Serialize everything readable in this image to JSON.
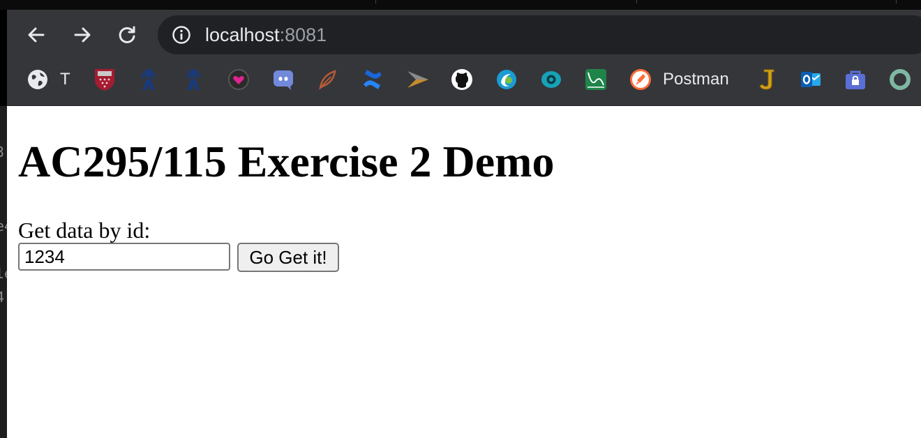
{
  "browser": {
    "address": {
      "host": "localhost",
      "port": ":8081"
    },
    "bookmarks": [
      {
        "icon": "globe-icon",
        "label": "T"
      },
      {
        "icon": "shield-crest-icon",
        "label": ""
      },
      {
        "icon": "butler-icon",
        "label": ""
      },
      {
        "icon": "butler-icon",
        "label": ""
      },
      {
        "icon": "heart-circle-icon",
        "label": ""
      },
      {
        "icon": "discord-icon",
        "label": ""
      },
      {
        "icon": "feather-icon",
        "label": ""
      },
      {
        "icon": "confluence-icon",
        "label": ""
      },
      {
        "icon": "arrow-play-icon",
        "label": ""
      },
      {
        "icon": "github-icon",
        "label": ""
      },
      {
        "icon": "swirl-circle-icon",
        "label": ""
      },
      {
        "icon": "eye-ring-icon",
        "label": ""
      },
      {
        "icon": "chart-line-icon",
        "label": ""
      },
      {
        "icon": "postman-icon",
        "label": "Postman"
      },
      {
        "icon": "letter-j-icon",
        "label": ""
      },
      {
        "icon": "outlook-icon",
        "label": ""
      },
      {
        "icon": "lock-bag-icon",
        "label": ""
      },
      {
        "icon": "ring-icon",
        "label": ""
      }
    ],
    "colors": {
      "toolbar": "#35363a",
      "omnibox": "#202124",
      "text": "#e8eaed",
      "port": "#9aa0a6"
    }
  },
  "page": {
    "heading": "AC295/115 Exercise 2 Demo",
    "form": {
      "label": "Get data by id:",
      "id_value": "1234",
      "button_label": "Go Get it!"
    }
  },
  "background_edge": [
    "3",
    "e4",
    "le",
    "4"
  ]
}
